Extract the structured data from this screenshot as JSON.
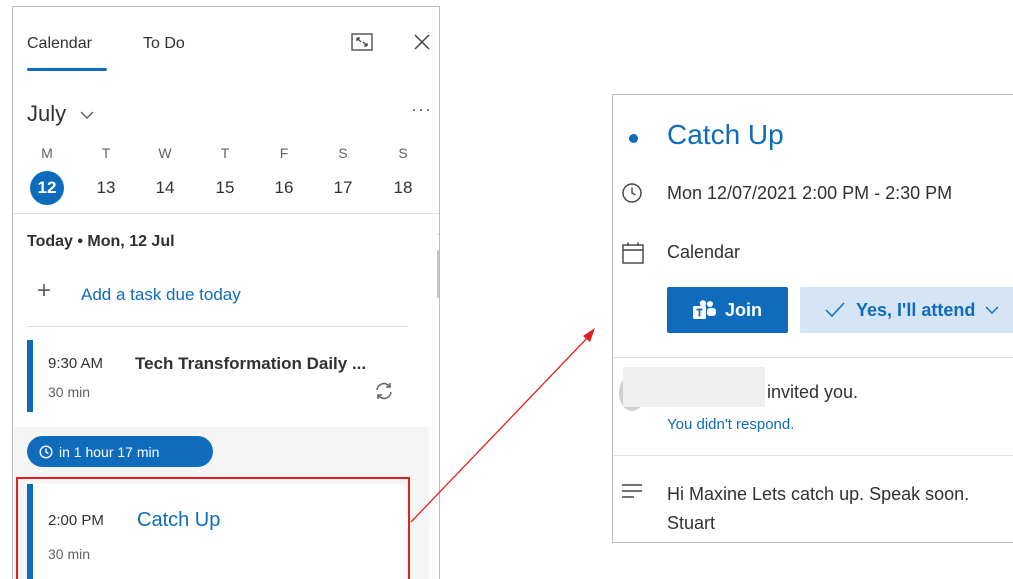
{
  "left_pane": {
    "tabs": [
      {
        "label": "Calendar",
        "active": true
      },
      {
        "label": "To Do",
        "active": false
      }
    ],
    "month": "July",
    "more": "···",
    "week": [
      {
        "letter": "M",
        "day": "12",
        "selected": true
      },
      {
        "letter": "T",
        "day": "13",
        "selected": false
      },
      {
        "letter": "W",
        "day": "14",
        "selected": false
      },
      {
        "letter": "T",
        "day": "15",
        "selected": false
      },
      {
        "letter": "F",
        "day": "16",
        "selected": false
      },
      {
        "letter": "S",
        "day": "17",
        "selected": false
      },
      {
        "letter": "S",
        "day": "18",
        "selected": false
      }
    ],
    "today_label": "Today • Mon, 12 Jul",
    "add_task_label": "Add a task due today",
    "events": [
      {
        "time": "9:30 AM",
        "duration": "30 min",
        "title": "Tech Transformation Daily ...",
        "recurring": true
      },
      {
        "time": "2:00 PM",
        "duration": "30 min",
        "title": "Catch Up",
        "recurring": false
      }
    ],
    "countdown_badge": "in 1 hour 17 min"
  },
  "detail_card": {
    "title": "Catch Up",
    "when": "Mon 12/07/2021 2:00 PM - 2:30 PM",
    "calendar": "Calendar",
    "join_label": "Join",
    "attend_label": "Yes, I'll attend",
    "invited_text": "invited you.",
    "response_status": "You didn't respond.",
    "notes": "Hi Maxine Lets catch up. Speak soon. Stuart"
  },
  "colors": {
    "accent": "#0f6cbd",
    "accent_light": "#d6e5f5",
    "highlight": "#e02020"
  },
  "icons": [
    "expand-icon",
    "close-icon",
    "chevron-down-icon",
    "more-icon",
    "plus-icon",
    "recurring-icon",
    "clock-icon",
    "calendar-icon",
    "teams-icon",
    "checkmark-icon",
    "notes-icon"
  ]
}
